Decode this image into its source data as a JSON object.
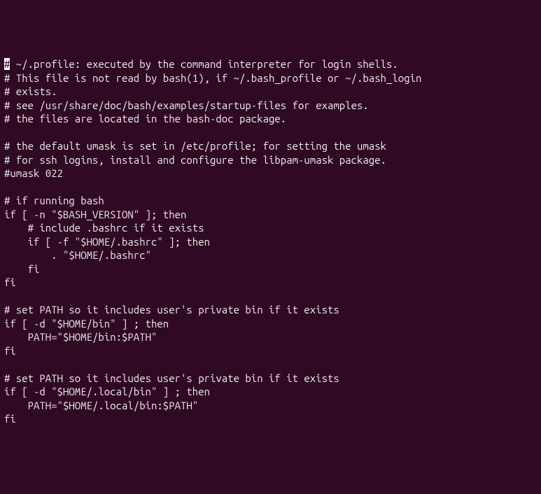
{
  "terminal": {
    "lines": [
      {
        "text": "# ~/.profile: executed by the command interpreter for login shells.",
        "cursor_at": 0
      },
      {
        "text": "# This file is not read by bash(1), if ~/.bash_profile or ~/.bash_login"
      },
      {
        "text": "# exists."
      },
      {
        "text": "# see /usr/share/doc/bash/examples/startup-files for examples."
      },
      {
        "text": "# the files are located in the bash-doc package."
      },
      {
        "text": ""
      },
      {
        "text": "# the default umask is set in /etc/profile; for setting the umask"
      },
      {
        "text": "# for ssh logins, install and configure the libpam-umask package."
      },
      {
        "text": "#umask 022"
      },
      {
        "text": ""
      },
      {
        "text": "# if running bash"
      },
      {
        "text": "if [ -n \"$BASH_VERSION\" ]; then"
      },
      {
        "text": "    # include .bashrc if it exists"
      },
      {
        "text": "    if [ -f \"$HOME/.bashrc\" ]; then"
      },
      {
        "text": "        . \"$HOME/.bashrc\""
      },
      {
        "text": "    fi"
      },
      {
        "text": "fi"
      },
      {
        "text": ""
      },
      {
        "text": "# set PATH so it includes user's private bin if it exists"
      },
      {
        "text": "if [ -d \"$HOME/bin\" ] ; then"
      },
      {
        "text": "    PATH=\"$HOME/bin:$PATH\""
      },
      {
        "text": "fi"
      },
      {
        "text": ""
      },
      {
        "text": "# set PATH so it includes user's private bin if it exists"
      },
      {
        "text": "if [ -d \"$HOME/.local/bin\" ] ; then"
      },
      {
        "text": "    PATH=\"$HOME/.local/bin:$PATH\""
      },
      {
        "text": "fi"
      }
    ]
  }
}
